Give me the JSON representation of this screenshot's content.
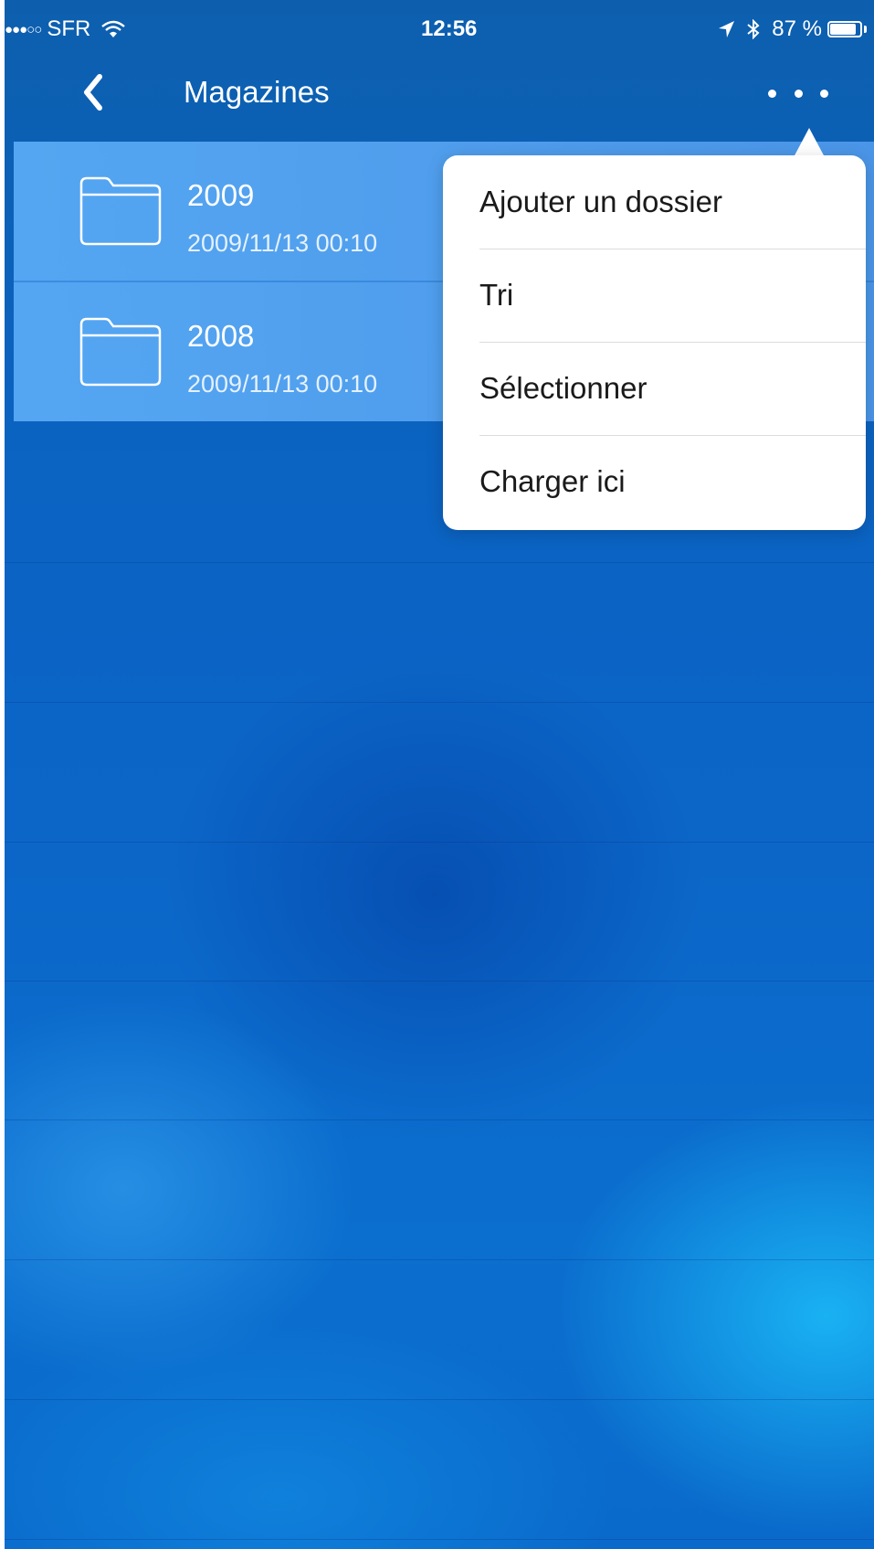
{
  "status_bar": {
    "signal": "●●●○○",
    "carrier": "SFR",
    "time": "12:56",
    "battery_percent": "87 %",
    "battery_level": 0.87,
    "icons": [
      "wifi-icon",
      "location-icon",
      "bluetooth-icon",
      "battery-icon"
    ]
  },
  "nav": {
    "title": "Magazines",
    "back_icon": "chevron-left-icon",
    "more_icon": "ellipsis-icon"
  },
  "files": [
    {
      "name": "2009",
      "date": "2009/11/13 00:10",
      "icon": "folder-icon"
    },
    {
      "name": "2008",
      "date": "2009/11/13 00:10",
      "icon": "folder-icon"
    }
  ],
  "menu": {
    "items": [
      {
        "label": "Ajouter un dossier"
      },
      {
        "label": "Tri"
      },
      {
        "label": "Sélectionner"
      },
      {
        "label": "Charger ici"
      }
    ]
  },
  "colors": {
    "background": "#0b66c8",
    "highlight_row": "#58aaf5",
    "menu_background": "#ffffff",
    "text_light": "#ffffff",
    "text_dark": "#1a1a1a"
  }
}
